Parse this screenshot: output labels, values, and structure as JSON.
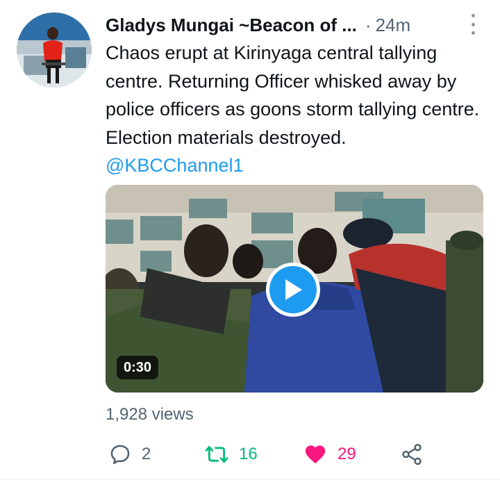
{
  "tweet": {
    "author_name": "Gladys Mungai ~Beacon of ...",
    "separator": "·",
    "time": "24m",
    "text": "Chaos erupt at Kirinyaga  central tallying centre. Returning Officer whisked away by police officers as goons storm tallying centre. Election materials destroyed.",
    "mention": "@KBCChannel1",
    "video_duration": "0:30",
    "views": "1,928 views"
  },
  "actions": {
    "replies": "2",
    "retweets": "16",
    "likes": "29"
  },
  "colors": {
    "accent": "#1d9bf0",
    "retweet": "#00ba7c",
    "like": "#f91880",
    "secondary_text": "#536471"
  }
}
